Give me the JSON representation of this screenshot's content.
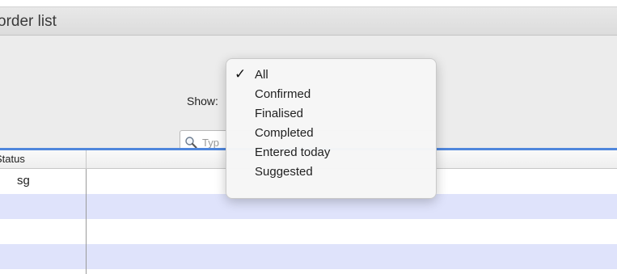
{
  "window": {
    "title": "order list"
  },
  "toolbar": {
    "show_label": "Show:",
    "search_placeholder": "Typ",
    "search_icon": "search-icon"
  },
  "table": {
    "columns": [
      "Status",
      ""
    ],
    "rows": [
      {
        "status": "sg"
      },
      {
        "status": ""
      },
      {
        "status": ""
      },
      {
        "status": ""
      }
    ]
  },
  "show_menu": {
    "selected": "All",
    "check_glyph": "✓",
    "options": [
      "All",
      "Confirmed",
      "Finalised",
      "Completed",
      "Entered today",
      "Suggested"
    ]
  },
  "colors": {
    "accent_line": "#4f86dc",
    "alt_row": "#dfe3fb",
    "window_bg": "#ececec"
  }
}
